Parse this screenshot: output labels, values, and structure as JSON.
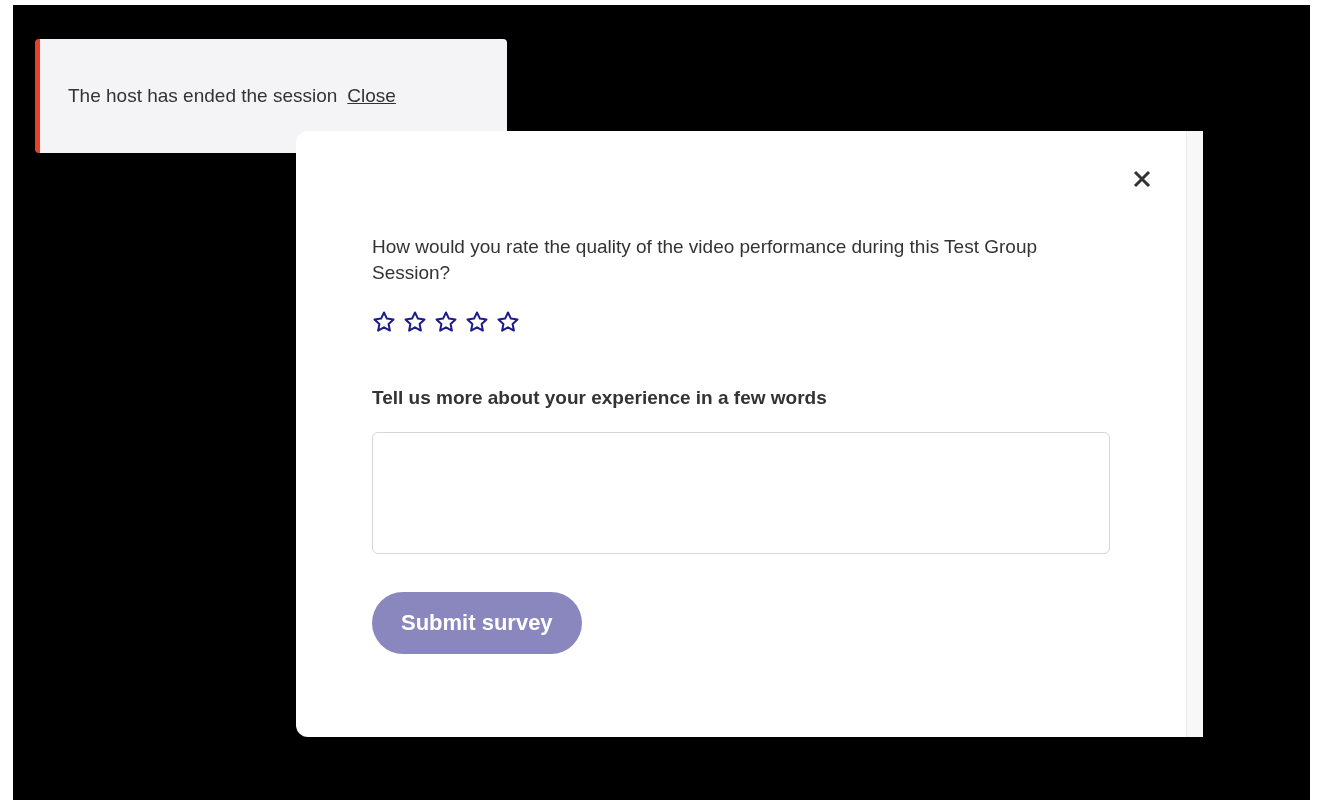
{
  "toast": {
    "message": "The host has ended the session",
    "link": "Close"
  },
  "survey": {
    "question": "How would you rate the quality of the video performance during this Test Group Session?",
    "stars": 0,
    "comment_label": "Tell us more about your experience in a few words",
    "submit": {
      "label": "Submit survey",
      "disabled": true
    }
  }
}
